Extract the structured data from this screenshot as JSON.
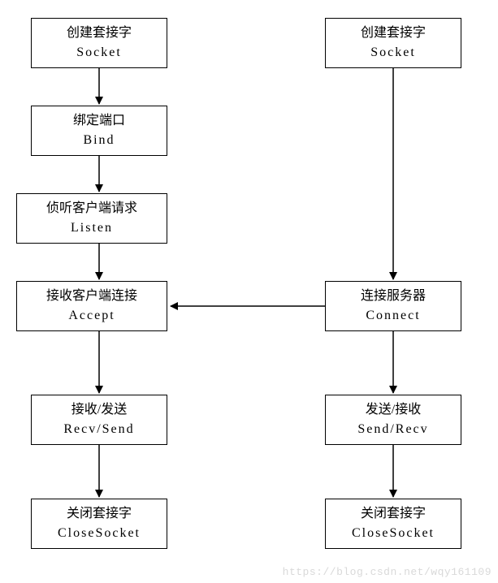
{
  "left": {
    "socket": {
      "cn": "创建套接字",
      "en": "Socket"
    },
    "bind": {
      "cn": "绑定端口",
      "en": "Bind"
    },
    "listen": {
      "cn": "侦听客户端请求",
      "en": "Listen"
    },
    "accept": {
      "cn": "接收客户端连接",
      "en": "Accept"
    },
    "recvsend": {
      "cn": "接收/发送",
      "en": "Recv/Send"
    },
    "close": {
      "cn": "关闭套接字",
      "en": "CloseSocket"
    }
  },
  "right": {
    "socket": {
      "cn": "创建套接字",
      "en": "Socket"
    },
    "connect": {
      "cn": "连接服务器",
      "en": "Connect"
    },
    "sendrecv": {
      "cn": "发送/接收",
      "en": "Send/Recv"
    },
    "close": {
      "cn": "关闭套接字",
      "en": "CloseSocket"
    }
  },
  "watermark": "https://blog.csdn.net/wqy161109"
}
